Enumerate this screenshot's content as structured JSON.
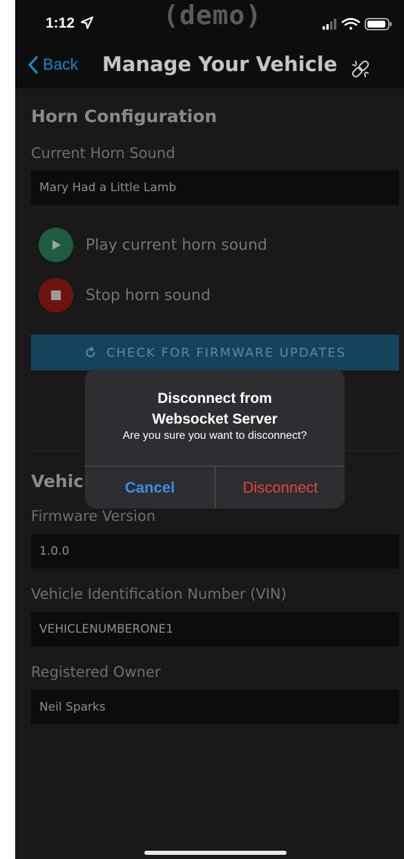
{
  "status_bar": {
    "time": "1:12",
    "watermark": "(demo)"
  },
  "nav": {
    "back_label": "Back",
    "title": "Manage Your Vehicle"
  },
  "horn": {
    "section_title": "Horn Configuration",
    "current_label": "Current Horn Sound",
    "current_value": "Mary Had a Little Lamb",
    "play_label": "Play current horn sound",
    "stop_label": "Stop horn sound",
    "firmware_button": "CHECK FOR FIRMWARE UPDATES"
  },
  "vehicle": {
    "section_title_partial": "Vehicl",
    "firmware_label": "Firmware Version",
    "firmware_value": "1.0.0",
    "vin_label": "Vehicle Identification Number (VIN)",
    "vin_value": "VEHICLENUMBERONE1",
    "owner_label": "Registered Owner",
    "owner_value": "Neil Sparks"
  },
  "dialog": {
    "title_line1": "Disconnect from",
    "title_line2": "Websocket Server",
    "message": "Are you sure you want to disconnect?",
    "cancel": "Cancel",
    "confirm": "Disconnect"
  },
  "colors": {
    "accent": "#1b87c6",
    "play": "#1f5d43",
    "stop": "#6e1410",
    "cancel": "#3a8ee6",
    "destructive": "#e5453b"
  }
}
